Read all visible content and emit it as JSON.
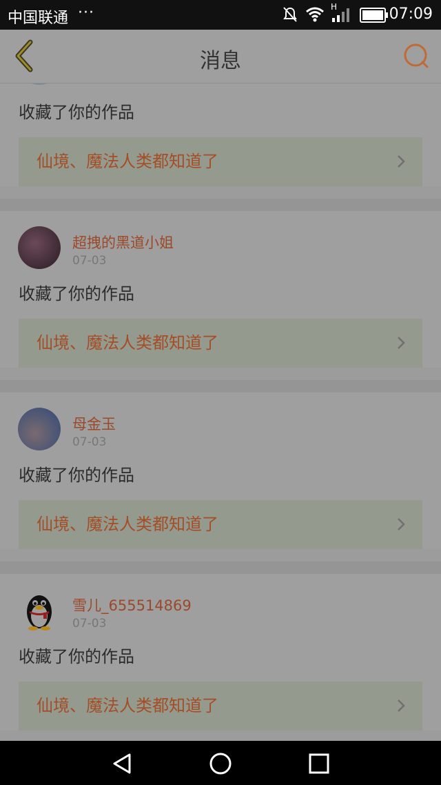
{
  "status_bar": {
    "carrier": "中国联通",
    "more": "···",
    "network_type": "H",
    "time": "07:09"
  },
  "header": {
    "title": "消息",
    "accent_color": "#c96a30"
  },
  "messages": [
    {
      "user": "",
      "date": "",
      "action": "收藏了你的作品",
      "work_title": "仙境、魔法人类都知道了"
    },
    {
      "user": "超拽的黑道小姐",
      "date": "07-03",
      "action": "收藏了你的作品",
      "work_title": "仙境、魔法人类都知道了"
    },
    {
      "user": "母金玉",
      "date": "07-03",
      "action": "收藏了你的作品",
      "work_title": "仙境、魔法人类都知道了"
    },
    {
      "user": "雪儿_655514869",
      "date": "07-03",
      "action": "收藏了你的作品",
      "work_title": "仙境、魔法人类都知道了"
    }
  ],
  "icons": {
    "back": "back-chevron-icon",
    "search": "search-icon",
    "mute": "mute-icon",
    "wifi": "wifi-icon",
    "signal": "signal-icon",
    "battery": "battery-icon",
    "nav_back": "nav-back-icon",
    "nav_home": "nav-home-icon",
    "nav_recent": "nav-recent-icon"
  }
}
